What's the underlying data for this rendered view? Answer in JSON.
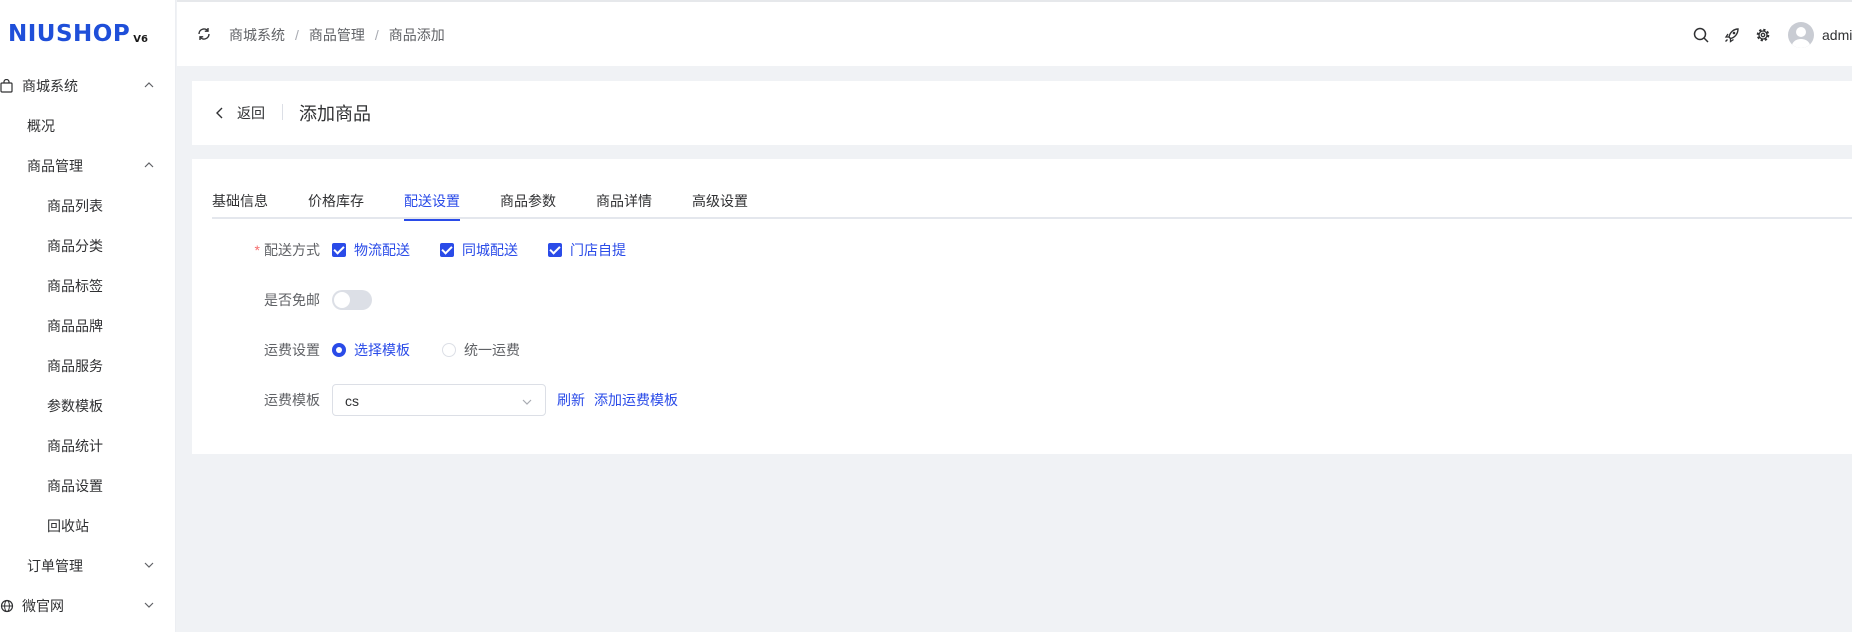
{
  "logo": {
    "main": "NIUSHOP",
    "sub": "V6"
  },
  "sidebar": {
    "items": [
      {
        "label": "商城系统",
        "level": 1,
        "icon": "bag-icon",
        "chevron": "up"
      },
      {
        "label": "概况",
        "level": 2
      },
      {
        "label": "商品管理",
        "level": 2,
        "chevron": "up"
      },
      {
        "label": "商品列表",
        "level": 3
      },
      {
        "label": "商品分类",
        "level": 3
      },
      {
        "label": "商品标签",
        "level": 3
      },
      {
        "label": "商品品牌",
        "level": 3
      },
      {
        "label": "商品服务",
        "level": 3
      },
      {
        "label": "参数模板",
        "level": 3
      },
      {
        "label": "商品统计",
        "level": 3
      },
      {
        "label": "商品设置",
        "level": 3
      },
      {
        "label": "回收站",
        "level": 3
      },
      {
        "label": "订单管理",
        "level": 2,
        "chevron": "down"
      },
      {
        "label": "微官网",
        "level": 1,
        "icon": "globe-icon",
        "chevron": "down"
      }
    ]
  },
  "header": {
    "breadcrumb": [
      "商城系统",
      "商品管理",
      "商品添加"
    ],
    "separator": "/",
    "username": "admin"
  },
  "title_bar": {
    "back_label": "返回",
    "title": "添加商品"
  },
  "tabs": [
    {
      "label": "基础信息",
      "active": false
    },
    {
      "label": "价格库存",
      "active": false
    },
    {
      "label": "配送设置",
      "active": true
    },
    {
      "label": "商品参数",
      "active": false
    },
    {
      "label": "商品详情",
      "active": false
    },
    {
      "label": "高级设置",
      "active": false
    }
  ],
  "form": {
    "delivery": {
      "required_mark": "*",
      "label": "配送方式",
      "options": [
        {
          "label": "物流配送",
          "checked": true
        },
        {
          "label": "同城配送",
          "checked": true
        },
        {
          "label": "门店自提",
          "checked": true
        }
      ]
    },
    "free_shipping": {
      "label": "是否免邮",
      "on": false
    },
    "freight_setting": {
      "label": "运费设置",
      "options": [
        {
          "label": "选择模板",
          "selected": true
        },
        {
          "label": "统一运费",
          "selected": false
        }
      ]
    },
    "freight_template": {
      "label": "运费模板",
      "value": "cs",
      "refresh_label": "刷新",
      "add_label": "添加运费模板"
    }
  },
  "colors": {
    "primary": "#2a4be8",
    "logo": "#1f4fd9",
    "required": "#f56c6c"
  }
}
